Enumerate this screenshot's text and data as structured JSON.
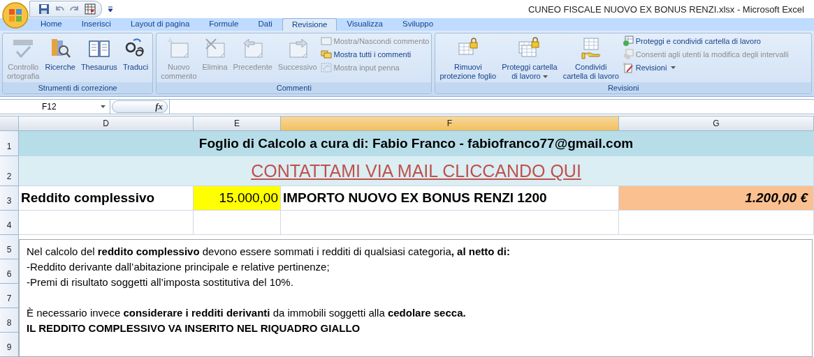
{
  "window": {
    "title": "CUNEO FISCALE NUOVO EX BONUS RENZI.xlsx - Microsoft Excel"
  },
  "tabs": [
    {
      "label": "Home",
      "selected": false
    },
    {
      "label": "Inserisci",
      "selected": false
    },
    {
      "label": "Layout di pagina",
      "selected": false
    },
    {
      "label": "Formule",
      "selected": false
    },
    {
      "label": "Dati",
      "selected": false
    },
    {
      "label": "Revisione",
      "selected": true
    },
    {
      "label": "Visualizza",
      "selected": false
    },
    {
      "label": "Sviluppo",
      "selected": false
    }
  ],
  "ribbon": {
    "groups": [
      {
        "label": "Strumenti di correzione",
        "buttons": [
          {
            "kind": "large",
            "lines": [
              "Controllo",
              "ortografia"
            ],
            "disabled": true,
            "dropdown": false
          },
          {
            "kind": "large",
            "lines": [
              "Ricerche"
            ],
            "disabled": false,
            "dropdown": false
          },
          {
            "kind": "large",
            "lines": [
              "Thesaurus"
            ],
            "disabled": false,
            "dropdown": false
          },
          {
            "kind": "large",
            "lines": [
              "Traduci"
            ],
            "disabled": false,
            "dropdown": false
          }
        ]
      },
      {
        "label": "Commenti",
        "buttons": [
          {
            "kind": "large",
            "lines": [
              "Nuovo",
              "commento"
            ],
            "disabled": true,
            "dropdown": false
          },
          {
            "kind": "large",
            "lines": [
              "Elimina"
            ],
            "disabled": true,
            "dropdown": false
          },
          {
            "kind": "large",
            "lines": [
              "Precedente"
            ],
            "disabled": true,
            "dropdown": false
          },
          {
            "kind": "large",
            "lines": [
              "Successivo"
            ],
            "disabled": true,
            "dropdown": false
          },
          {
            "kind": "small",
            "lines": [
              "Mostra/Nascondi commento"
            ],
            "disabled": true,
            "dropdown": false
          },
          {
            "kind": "small",
            "lines": [
              "Mostra tutti i commenti"
            ],
            "disabled": false,
            "dropdown": false
          },
          {
            "kind": "small",
            "lines": [
              "Mostra input penna"
            ],
            "disabled": true,
            "dropdown": false
          }
        ]
      },
      {
        "label": "Revisioni",
        "buttons": [
          {
            "kind": "large",
            "lines": [
              "Rimuovi",
              "protezione foglio"
            ],
            "disabled": false,
            "dropdown": false
          },
          {
            "kind": "large",
            "lines": [
              "Proteggi cartella",
              "di lavoro"
            ],
            "disabled": false,
            "dropdown": true
          },
          {
            "kind": "large",
            "lines": [
              "Condividi",
              "cartella di lavoro"
            ],
            "disabled": false,
            "dropdown": false
          },
          {
            "kind": "small",
            "lines": [
              "Proteggi e condividi cartella di lavoro"
            ],
            "disabled": false,
            "dropdown": false
          },
          {
            "kind": "small",
            "lines": [
              "Consenti agli utenti la modifica degli intervalli"
            ],
            "disabled": true,
            "dropdown": false
          },
          {
            "kind": "small",
            "lines": [
              "Revisioni"
            ],
            "disabled": false,
            "dropdown": true
          }
        ]
      }
    ]
  },
  "formula_bar": {
    "name_box": "F12",
    "function_glyph": "fx"
  },
  "sheet": {
    "columns": [
      {
        "label": "D",
        "selected": false
      },
      {
        "label": "E",
        "selected": false
      },
      {
        "label": "F",
        "selected": true
      },
      {
        "label": "G",
        "selected": false
      }
    ],
    "row_numbers": [
      "1",
      "2",
      "3",
      "4",
      "5",
      "6",
      "7",
      "8",
      "9"
    ],
    "title_row": "Foglio di Calcolo a cura di: Fabio Franco - fabiofranco77@gmail.com",
    "link_row": "CONTATTAMI VIA MAIL CLICCANDO QUI",
    "calc_row": {
      "label": "Reddito complessivo",
      "input": "15.000,00",
      "description": "IMPORTO NUOVO EX BONUS RENZI 1200",
      "result": "1.200,00 €"
    },
    "note": {
      "paragraphs": [
        [
          {
            "text": "Nel calcolo del **reddito complessivo** devono essere sommati i redditi di qualsiasi categoria**, al netto di:**",
            "bold": false
          },
          {
            "text": "-Reddito derivante dall’abitazione principale e relative pertinenze;",
            "bold": false
          },
          {
            "text": "-Premi di risultato soggetti all’imposta sostitutiva del 10%.",
            "bold": false
          }
        ],
        [
          {
            "text": "È necessario invece **considerare i redditi derivanti** da immobili soggetti alla **cedolare secca.**",
            "bold": false
          },
          {
            "text": "IL REDDITO COMPLESSIVO VA INSERITO NEL RIQUADRO GIALLO",
            "bold": true
          }
        ]
      ]
    }
  }
}
